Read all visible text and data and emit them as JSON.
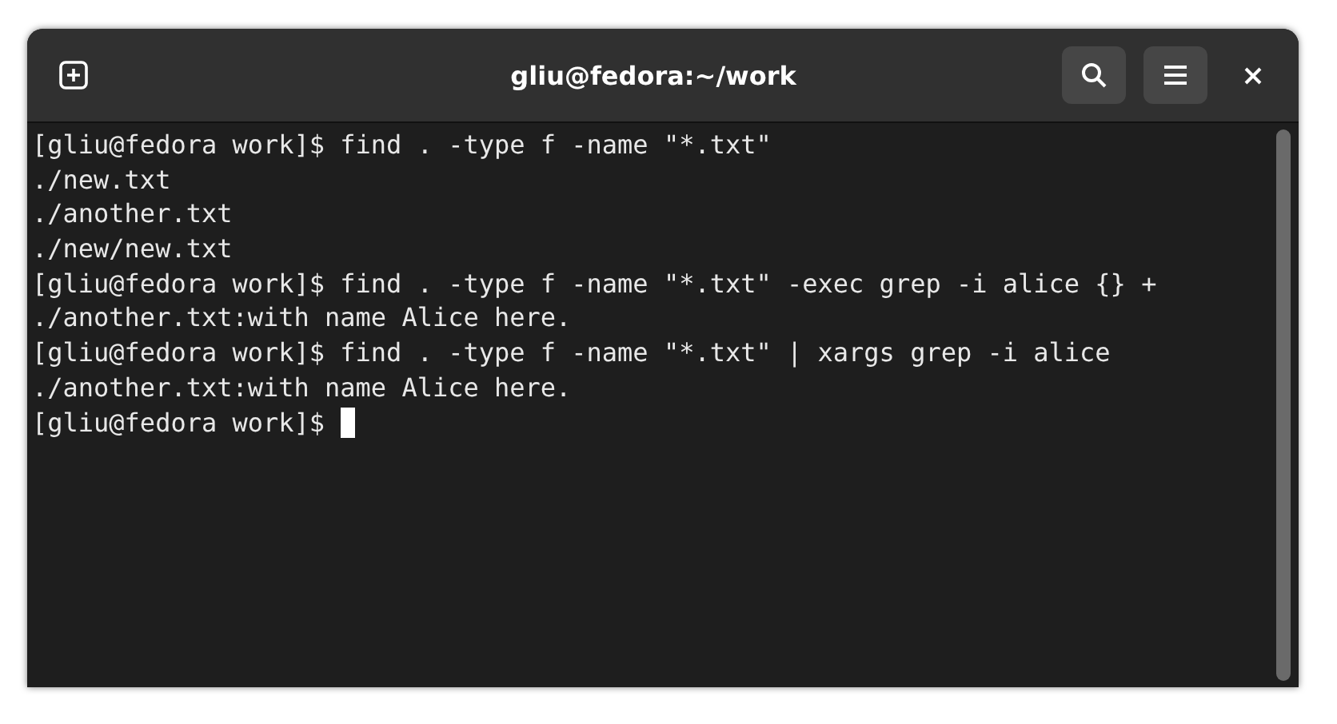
{
  "window": {
    "title": "gliu@fedora:~/work"
  },
  "terminal": {
    "lines": [
      "[gliu@fedora work]$ find . -type f -name \"*.txt\"",
      "./new.txt",
      "./another.txt",
      "./new/new.txt",
      "[gliu@fedora work]$ find . -type f -name \"*.txt\" -exec grep -i alice {} +",
      "./another.txt:with name Alice here.",
      "[gliu@fedora work]$ find . -type f -name \"*.txt\" | xargs grep -i alice",
      "./another.txt:with name Alice here.",
      "[gliu@fedora work]$ "
    ],
    "cursor_visible": true
  }
}
